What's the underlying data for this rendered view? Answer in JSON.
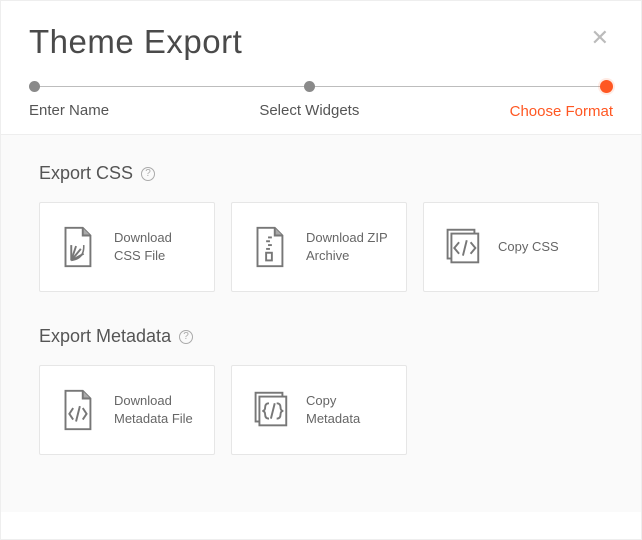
{
  "dialog": {
    "title": "Theme Export"
  },
  "stepper": {
    "steps": [
      {
        "label": "Enter Name"
      },
      {
        "label": "Select Widgets"
      },
      {
        "label": "Choose Format"
      }
    ],
    "activeIndex": 2
  },
  "sections": {
    "css": {
      "title": "Export CSS",
      "cards": [
        {
          "label": "Download CSS File"
        },
        {
          "label": "Download ZIP Archive"
        },
        {
          "label": "Copy CSS"
        }
      ]
    },
    "metadata": {
      "title": "Export Metadata",
      "cards": [
        {
          "label": "Download Metadata File"
        },
        {
          "label": "Copy Metadata"
        }
      ]
    }
  },
  "colors": {
    "accent": "#ff5722"
  }
}
